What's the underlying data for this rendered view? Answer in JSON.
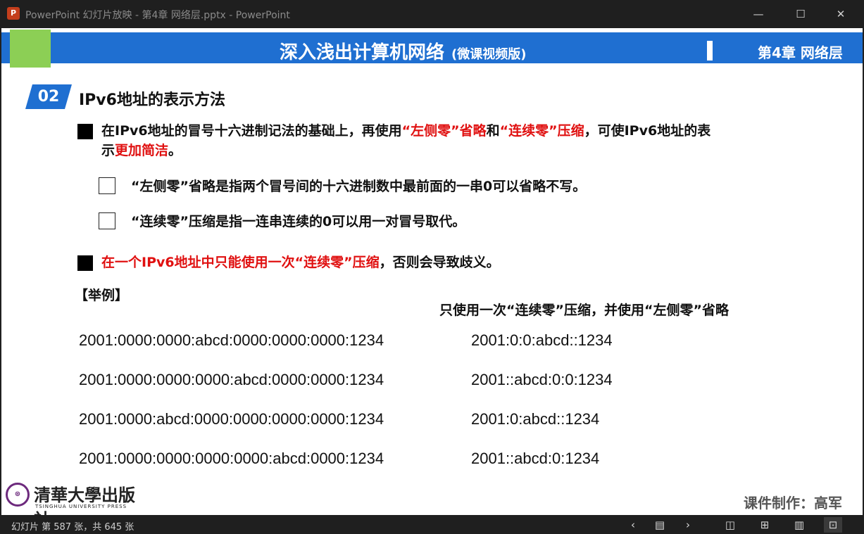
{
  "window": {
    "title": "PowerPoint 幻灯片放映  -  第4章 网络层.pptx - PowerPoint",
    "app_icon": "P",
    "controls": {
      "minimize": "—",
      "maximize": "☐",
      "close": "✕"
    }
  },
  "slide": {
    "banner_title": "深入浅出计算机网络",
    "banner_subtitle": "(微课视频版)",
    "chapter": "第4章 网络层",
    "section_number": "02",
    "section_title": "IPv6地址的表示方法",
    "bullet1": {
      "p1": "在IPv6地址的冒号十六进制记法的基础上，再使用",
      "r1": "“左侧零”省略",
      "p2": "和",
      "r2": "“连续零”压缩",
      "p3": "，可使IPv6地址的表",
      "line2_a": "示",
      "line2_red": "更加简洁",
      "line2_b": "。"
    },
    "sub1": "“左侧零”省略是指两个冒号间的十六进制数中最前面的一串0可以省略不写。",
    "sub2": "“连续零”压缩是指一连串连续的0可以用一对冒号取代。",
    "bullet2": {
      "red": "在一个IPv6地址中只能使用一次“连续零”压缩",
      "rest": "，否则会导致歧义。"
    },
    "example_label": "【举例】",
    "column_heading": "只使用一次“连续零”压缩，并使用“左侧零”省略",
    "examples": [
      {
        "full": "2001:0000:0000:abcd:0000:0000:0000:1234",
        "short": "2001:0:0:abcd::1234"
      },
      {
        "full": "2001:0000:0000:0000:abcd:0000:0000:1234",
        "short": "2001::abcd:0:0:1234"
      },
      {
        "full": "2001:0000:abcd:0000:0000:0000:0000:1234",
        "short": "2001:0:abcd::1234"
      },
      {
        "full": "2001:0000:0000:0000:0000:abcd:0000:1234",
        "short": "2001::abcd:0:1234"
      }
    ],
    "publisher_cn": "清華大學出版社",
    "publisher_en": "TSINGHUA UNIVERSITY PRESS",
    "author": "课件制作：高军"
  },
  "statusbar": {
    "slide_count": "幻灯片 第 587 张，共 645 张"
  },
  "colors": {
    "banner_blue": "#1f6fd1",
    "accent_green": "#8ccf55",
    "highlight_red": "#e01010"
  }
}
